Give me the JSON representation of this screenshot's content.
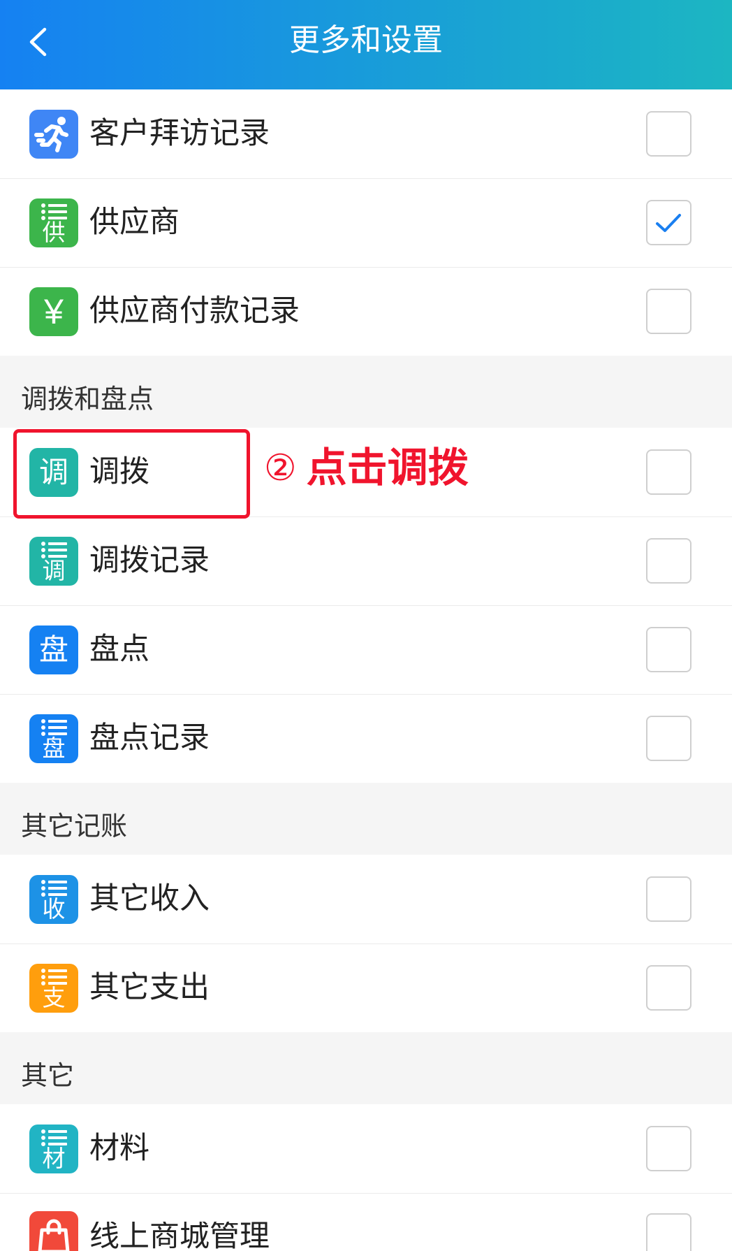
{
  "header": {
    "title": "更多和设置",
    "back_icon": "chevron-left-icon",
    "gradient_start": "#1581f2",
    "gradient_end": "#1cb6c2"
  },
  "colors": {
    "section_bg": "#f5f5f5",
    "check": "#1a7ff0",
    "annotation": "#f0142d"
  },
  "groups": [
    {
      "items": [
        {
          "label": "客户拜访记录",
          "icon": "running-person-icon",
          "icon_color": "#3f86f5",
          "checked": false
        },
        {
          "label": "供应商",
          "icon": "supplier-list-icon",
          "glyph": "供",
          "icon_color": "#3cb54b",
          "checked": true
        },
        {
          "label": "供应商付款记录",
          "icon": "yuan-icon",
          "glyph": "¥",
          "icon_color": "#3cb54b",
          "checked": false
        }
      ]
    },
    {
      "title": "调拨和盘点",
      "items": [
        {
          "label": "调拨",
          "icon": "transfer-icon",
          "glyph": "调",
          "icon_color": "#22b5a6",
          "checked": false
        },
        {
          "label": "调拨记录",
          "icon": "transfer-list-icon",
          "glyph": "调",
          "icon_color": "#22b5a6",
          "checked": false
        },
        {
          "label": "盘点",
          "icon": "stocktake-icon",
          "glyph": "盘",
          "icon_color": "#1581f2",
          "checked": false
        },
        {
          "label": "盘点记录",
          "icon": "stocktake-list-icon",
          "glyph": "盘",
          "icon_color": "#1581f2",
          "checked": false
        }
      ]
    },
    {
      "title": "其它记账",
      "items": [
        {
          "label": "其它收入",
          "icon": "income-list-icon",
          "glyph": "收",
          "icon_color": "#1d92e6",
          "checked": false
        },
        {
          "label": "其它支出",
          "icon": "expense-list-icon",
          "glyph": "支",
          "icon_color": "#ff9e0d",
          "checked": false
        }
      ]
    },
    {
      "title": "其它",
      "items": [
        {
          "label": "材料",
          "icon": "material-list-icon",
          "glyph": "材",
          "icon_color": "#21b4c4",
          "checked": false
        },
        {
          "label": "线上商城管理",
          "icon": "shopping-bag-icon",
          "icon_color": "#f1493a",
          "checked": false
        }
      ]
    }
  ],
  "annotation": {
    "marker": "②",
    "text": "点击调拨"
  }
}
